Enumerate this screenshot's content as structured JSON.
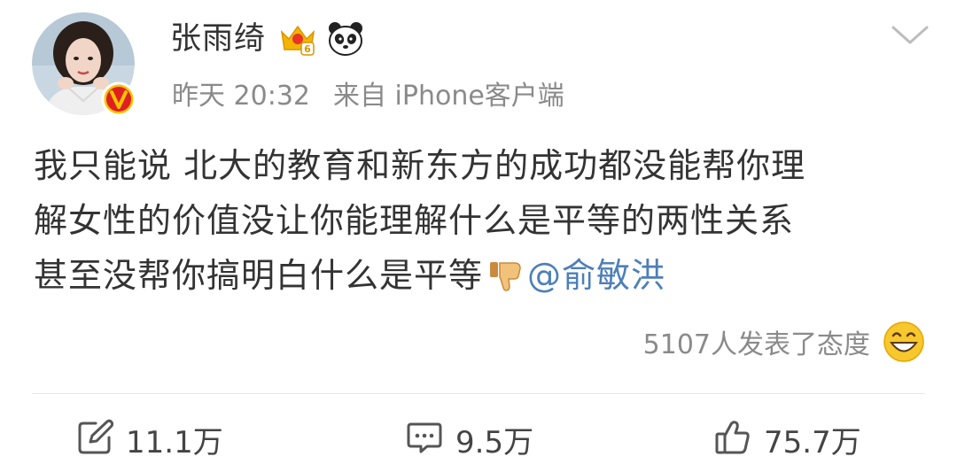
{
  "post": {
    "author": {
      "name": "张雨绮",
      "verified_badge": "V",
      "icons": [
        "vip-crown-icon",
        "panda-icon"
      ]
    },
    "time": "昨天 20:32",
    "source": "来自 iPhone客户端",
    "content": {
      "line1": "我只能说 北大的教育和新东方的成功都没能帮你理",
      "line2": "解女性的价值没让你能理解什么是平等的两性关系",
      "line3_text": "甚至没帮你搞明白什么是平等",
      "line3_emoji": "thumbs-down-icon",
      "mention": "@俞敏洪"
    },
    "attitude": {
      "text": "5107人发表了态度",
      "emoji": "grinning-emoji-icon"
    },
    "actions": {
      "repost_count": "11.1万",
      "comment_count": "9.5万",
      "like_count": "75.7万"
    }
  },
  "colors": {
    "text": "#333333",
    "meta": "#8a8a8a",
    "mention": "#4d7fb8",
    "verified": "#e02020",
    "vip_gold": "#f0b400"
  }
}
